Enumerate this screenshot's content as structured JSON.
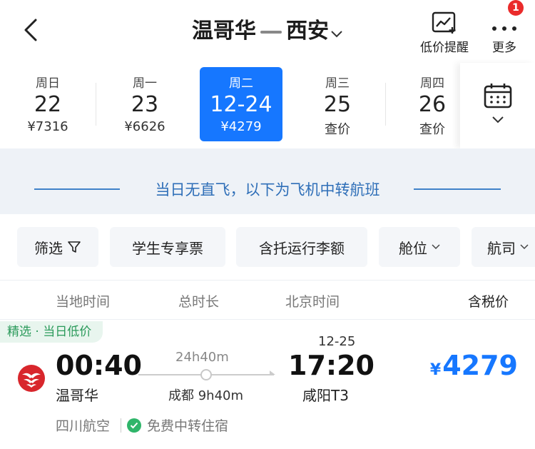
{
  "header": {
    "origin": "温哥华",
    "destination": "西安",
    "price_alert_label": "低价提醒",
    "more_label": "更多",
    "notification_count": "1"
  },
  "dates": [
    {
      "weekday": "周日",
      "day": "22",
      "price": "¥7316",
      "active": false
    },
    {
      "weekday": "周一",
      "day": "23",
      "price": "¥6626",
      "active": false
    },
    {
      "weekday": "周二",
      "day": "12-24",
      "price": "¥4279",
      "active": true
    },
    {
      "weekday": "周三",
      "day": "25",
      "price": "查价",
      "active": false
    },
    {
      "weekday": "周四",
      "day": "26",
      "price": "查价",
      "active": false
    }
  ],
  "banner": {
    "text": "当日无直飞，以下为飞机中转航班"
  },
  "filters": {
    "filter": "筛选",
    "student": "学生专享票",
    "baggage": "含托运行李额",
    "cabin": "舱位",
    "airline": "航司"
  },
  "columns": {
    "local_time": "当地时间",
    "duration": "总时长",
    "beijing_time": "北京时间",
    "tax_price": "含税价"
  },
  "flight": {
    "tag": "精选 · 当日低价",
    "dep_time": "00:40",
    "dep_airport": "温哥华",
    "duration": "24h40m",
    "transfer": "成都 9h40m",
    "arr_date": "12-25",
    "arr_time": "17:20",
    "arr_airport": "咸阳T3",
    "currency": "¥",
    "price": "4279",
    "airline": "四川航空",
    "perk": "免费中转住宿"
  },
  "colors": {
    "accent": "#1677ff",
    "banner_bg": "#eef2f7",
    "tag_green": "#2a9a5a",
    "badge_red": "#ea2b2b"
  }
}
